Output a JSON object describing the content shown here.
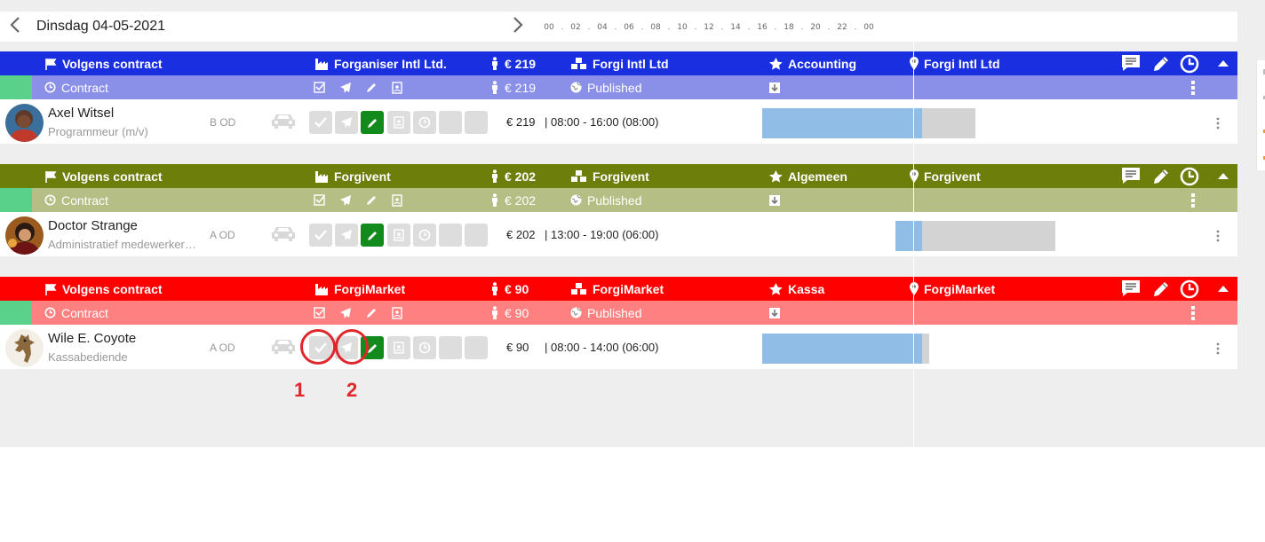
{
  "date_header": {
    "prev_icon": "chevron-left-icon",
    "date_label": "Dinsdag 04-05-2021",
    "next_icon": "chevron-right-icon",
    "hour_ticks": [
      "00",
      ".",
      "02",
      ".",
      "04",
      ".",
      "06",
      ".",
      "08",
      ".",
      "10",
      ".",
      "12",
      ".",
      "14",
      ".",
      "16",
      ".",
      "18",
      ".",
      "20",
      ".",
      "22",
      ".",
      "00"
    ]
  },
  "groups": [
    {
      "header": {
        "contract": "Volgens contract",
        "company": "Forganiser Intl Ltd.",
        "cost": "€ 219",
        "client": "Forgi Intl Ltd",
        "function": "Accounting",
        "location": "Forgi Intl Ltd"
      },
      "sub": {
        "status": "Contract",
        "cost": "€ 219",
        "published": "Published"
      },
      "employee": {
        "name": "Axel Witsel",
        "role": "Programmeur (m/v)",
        "code": "B OD",
        "cost": "€ 219",
        "time": "| 08:00 - 16:00 (08:00)"
      },
      "colors": {
        "header": "#1a2fe0",
        "sub": "#8a8fe8"
      }
    },
    {
      "header": {
        "contract": "Volgens contract",
        "company": "Forgivent",
        "cost": "€ 202",
        "client": "Forgivent",
        "function": "Algemeen",
        "location": "Forgivent"
      },
      "sub": {
        "status": "Contract",
        "cost": "€ 202",
        "published": "Published"
      },
      "employee": {
        "name": "Doctor Strange",
        "role": "Administratief medewerker…",
        "code": "A OD",
        "cost": "€ 202",
        "time": "| 13:00 - 19:00 (06:00)"
      },
      "colors": {
        "header": "#6e7e0b",
        "sub": "#b5be84"
      }
    },
    {
      "header": {
        "contract": "Volgens contract",
        "company": "ForgiMarket",
        "cost": "€ 90",
        "client": "ForgiMarket",
        "function": "Kassa",
        "location": "ForgiMarket"
      },
      "sub": {
        "status": "Contract",
        "cost": "€ 90",
        "published": "Published"
      },
      "employee": {
        "name": "Wile E. Coyote",
        "role": "Kassabediende",
        "code": "A OD",
        "cost": "€ 90",
        "time": "| 08:00 - 14:00 (06:00)"
      },
      "colors": {
        "header": "#ff0000",
        "sub": "#ff8080"
      }
    }
  ],
  "annotations": [
    "1",
    "2"
  ],
  "colors": {
    "planned_bar": "#8fbde6",
    "remaining_bar": "#d3d3d3",
    "active_action": "#138a1c",
    "collapse": "#dd3333",
    "status_strip": "#59d18b"
  }
}
